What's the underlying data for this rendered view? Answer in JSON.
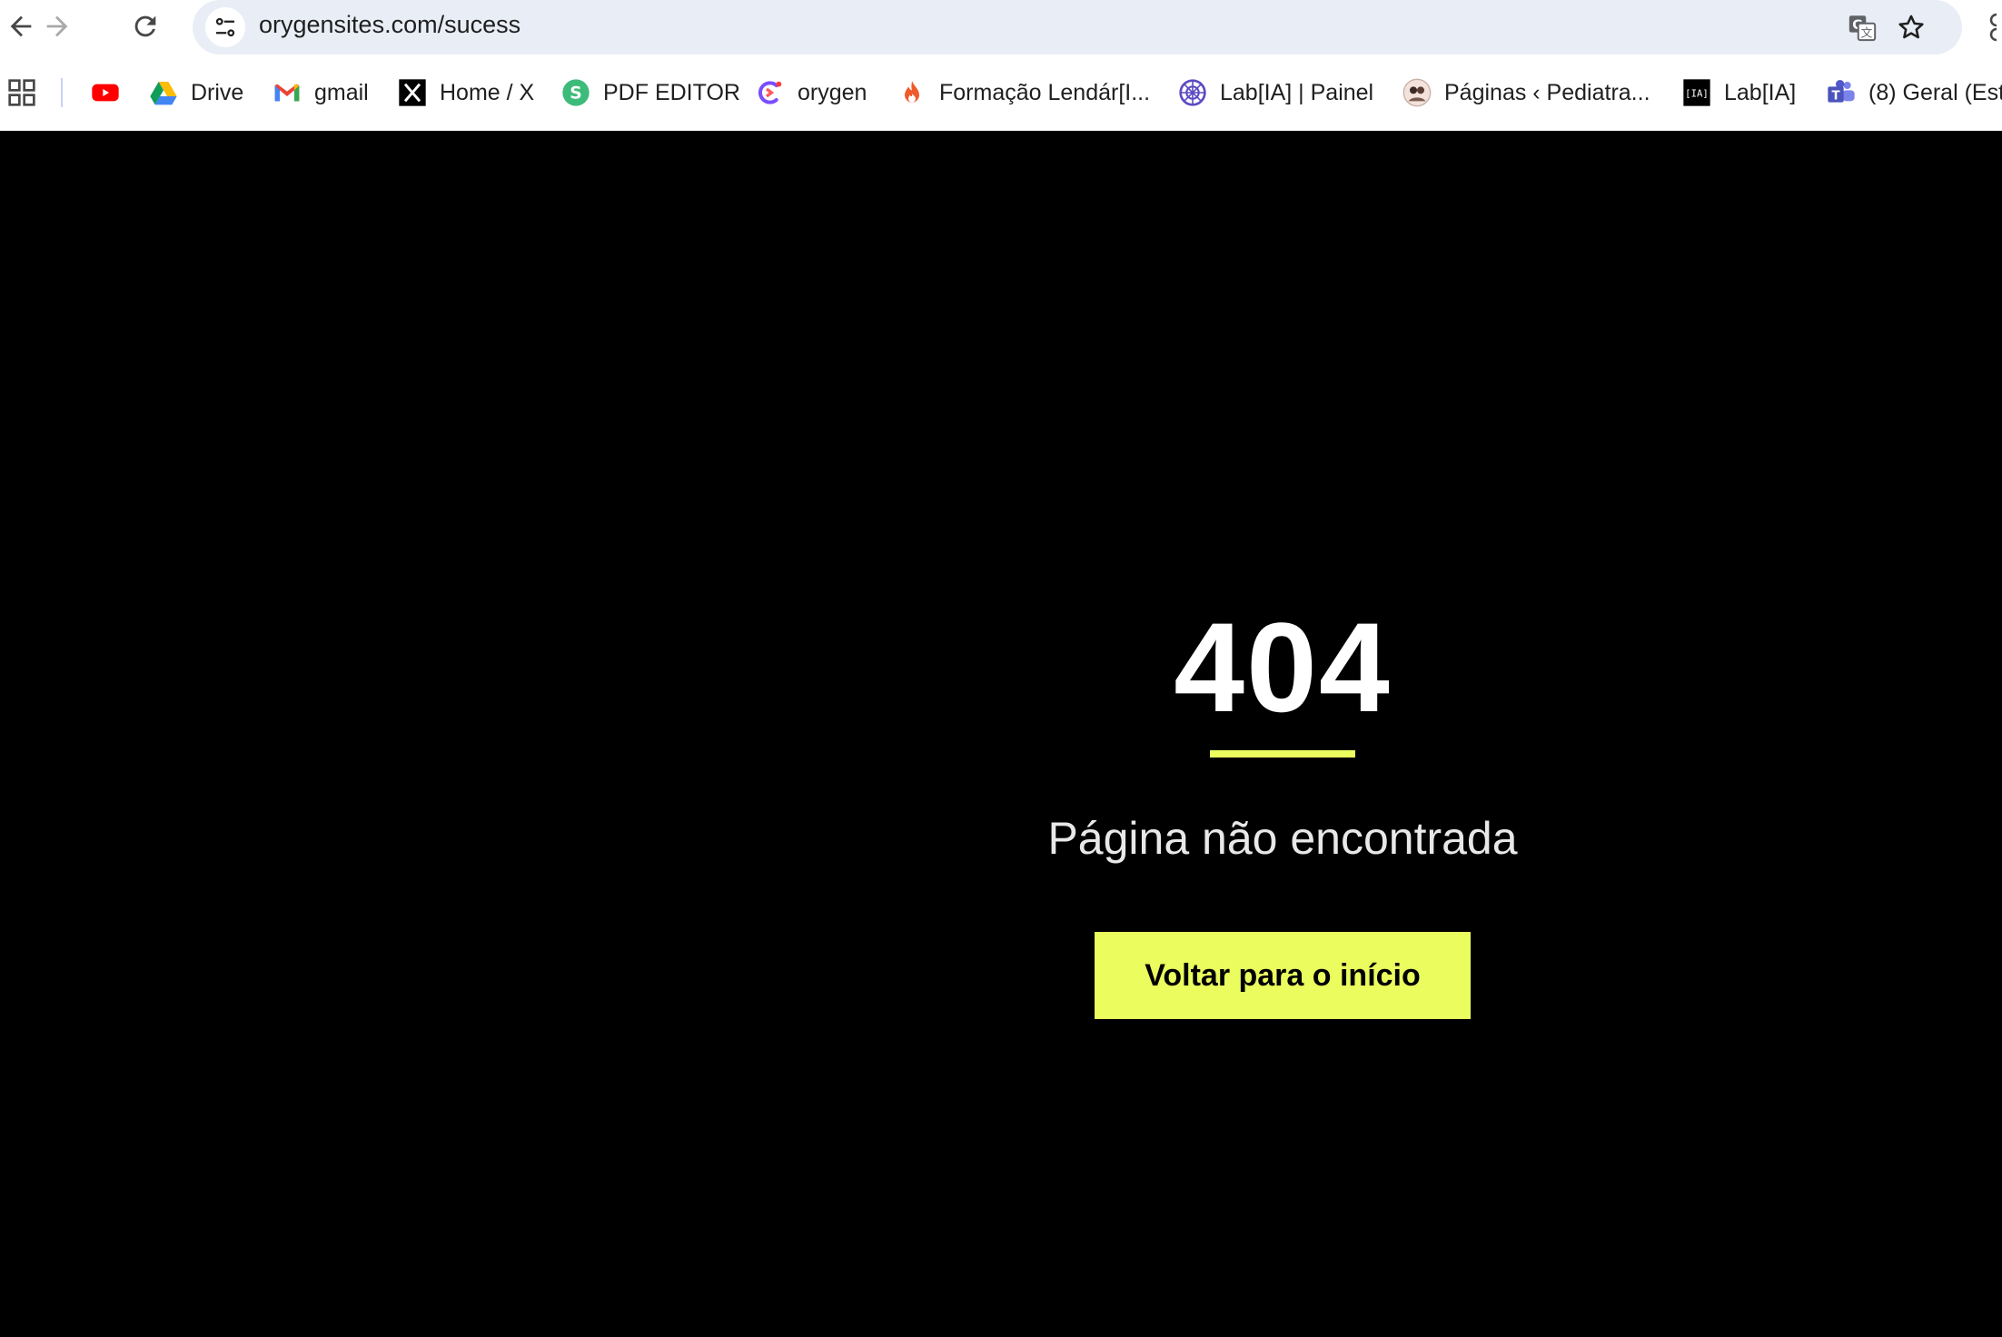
{
  "browser": {
    "url": "orygensites.com/sucess",
    "bookmarks": [
      {
        "label": "",
        "icon": "youtube-icon"
      },
      {
        "label": "Drive",
        "icon": "google-drive-icon"
      },
      {
        "label": "gmail",
        "icon": "gmail-icon"
      },
      {
        "label": "Home / X",
        "icon": "x-icon"
      },
      {
        "label": "PDF EDITOR",
        "icon": "pdf-editor-icon"
      },
      {
        "label": "orygen",
        "icon": "orygen-icon"
      },
      {
        "label": "Formação Lendár[I...",
        "icon": "flame-icon"
      },
      {
        "label": "Lab[IA] | Painel",
        "icon": "lab-painel-icon"
      },
      {
        "label": "Páginas ‹ Pediatra...",
        "icon": "pediatra-icon"
      },
      {
        "label": "Lab[IA]",
        "icon": "lab-ia-icon"
      },
      {
        "label": "(8) Geral (Est",
        "icon": "teams-icon"
      }
    ]
  },
  "page": {
    "code": "404",
    "message": "Página não encontrada",
    "button_label": "Voltar para o início"
  },
  "colors": {
    "background": "#000000",
    "accent": "#eafc5e",
    "text": "#ffffff"
  }
}
